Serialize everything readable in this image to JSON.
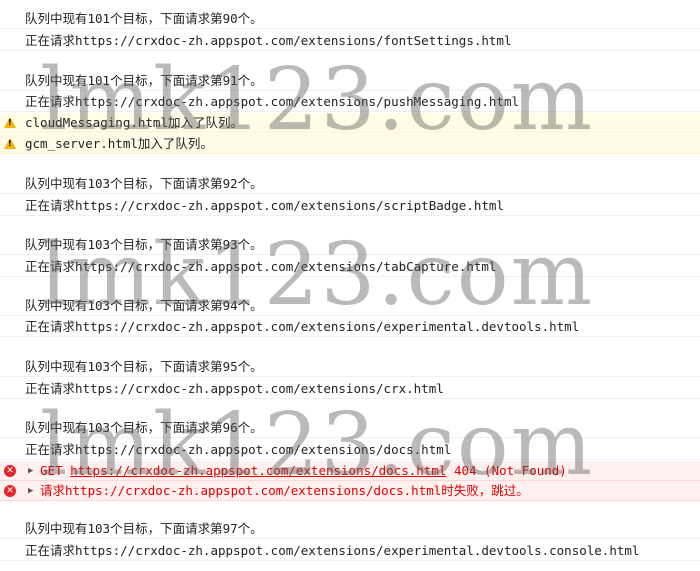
{
  "watermark": "lmk123.com",
  "colors": {
    "warning": "#f2b400",
    "error": "#e2262b",
    "error_text": "#e00000"
  },
  "icons": {
    "warning": "warning-triangle-icon",
    "error": "error-circle-icon",
    "expand": "expand-arrow-icon"
  },
  "log": {
    "r1": "队列中现有101个目标，下面请求第90个。",
    "r2": "正在请求https://crxdoc-zh.appspot.com/extensions/fontSettings.html",
    "r3": "队列中现有101个目标，下面请求第91个。",
    "r4": "正在请求https://crxdoc-zh.appspot.com/extensions/pushMessaging.html",
    "r5": "cloudMessaging.html加入了队列。",
    "r6": "gcm_server.html加入了队列。",
    "r7": "队列中现有103个目标，下面请求第92个。",
    "r8": "正在请求https://crxdoc-zh.appspot.com/extensions/scriptBadge.html",
    "r9": "队列中现有103个目标，下面请求第93个。",
    "r10": "正在请求https://crxdoc-zh.appspot.com/extensions/tabCapture.html",
    "r11": "队列中现有103个目标，下面请求第94个。",
    "r12": "正在请求https://crxdoc-zh.appspot.com/extensions/experimental.devtools.html",
    "r13": "队列中现有103个目标，下面请求第95个。",
    "r14": "正在请求https://crxdoc-zh.appspot.com/extensions/crx.html",
    "r15": "队列中现有103个目标，下面请求第96个。",
    "r16": "正在请求https://crxdoc-zh.appspot.com/extensions/docs.html",
    "r17_method": "GET",
    "r17_url": "https://crxdoc-zh.appspot.com/extensions/docs.html",
    "r17_status": "404 (Not Found)",
    "r18": "请求https://crxdoc-zh.appspot.com/extensions/docs.html时失败，跳过。",
    "r19": "队列中现有103个目标，下面请求第97个。",
    "r20": "正在请求https://crxdoc-zh.appspot.com/extensions/experimental.devtools.console.html"
  }
}
